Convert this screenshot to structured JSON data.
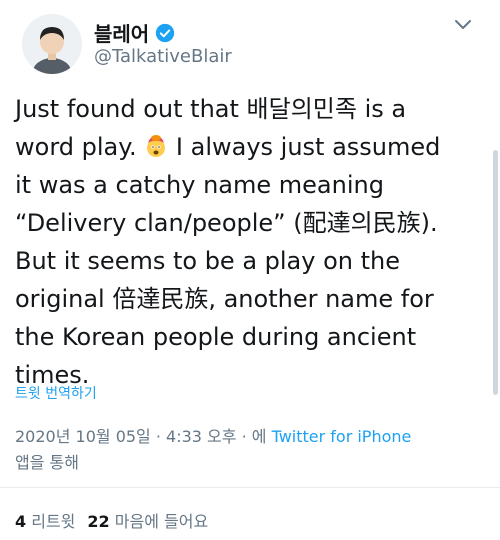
{
  "author": {
    "display_name": "블레어",
    "handle": "@TalkativeBlair"
  },
  "tweet": {
    "lines": [
      [
        "Just found out that 배달의민족 is a"
      ],
      [
        "word play. ",
        "emoji",
        " I always just assumed"
      ],
      [
        "it was a catchy name meaning"
      ],
      [
        "“Delivery clan/people” (配達의民族)."
      ],
      [
        "But it seems to be a play on the"
      ],
      [
        "original 倍達民族, another name for"
      ],
      [
        "the Korean people during ancient"
      ],
      [
        "times."
      ]
    ],
    "emoji_icon": "exploding-head-emoji"
  },
  "translate_label": "트윗 번역하기",
  "meta": {
    "timestamp": "2020년 10월 05일 · 4:33 오후 · 에",
    "source": "Twitter for iPhone",
    "suffix": "앱을 통해"
  },
  "stats": {
    "retweets_count": "4",
    "retweets_label": "리트윗",
    "likes_count": "22",
    "likes_label": "마음에 들어요"
  },
  "colors": {
    "accent": "#1da1f2",
    "secondary": "#657786",
    "text": "#14171a"
  }
}
